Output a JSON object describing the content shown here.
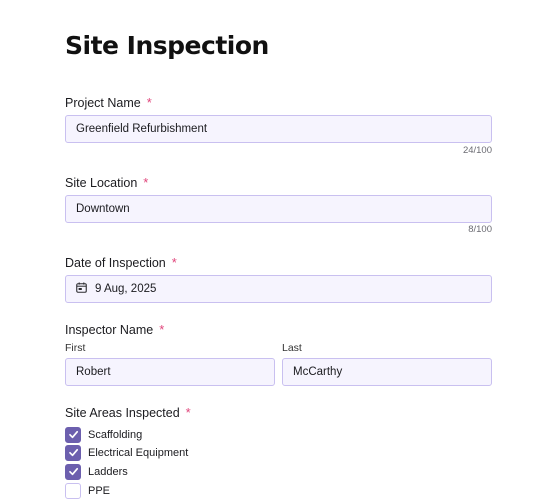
{
  "page": {
    "title": "Site Inspection"
  },
  "project_name": {
    "label": "Project Name",
    "required": "*",
    "value": "Greenfield Refurbishment",
    "counter": "24/100"
  },
  "site_location": {
    "label": "Site Location",
    "required": "*",
    "value": "Downtown",
    "counter": "8/100"
  },
  "date_of_inspection": {
    "label": "Date of Inspection",
    "required": "*",
    "value": "9 Aug, 2025",
    "icon": "calendar-icon"
  },
  "inspector_name": {
    "label": "Inspector Name",
    "required": "*",
    "first_label": "First",
    "first_value": "Robert",
    "last_label": "Last",
    "last_value": "McCarthy"
  },
  "site_areas": {
    "label": "Site Areas Inspected",
    "required": "*",
    "options": [
      {
        "label": "Scaffolding",
        "checked": true
      },
      {
        "label": "Electrical Equipment",
        "checked": true
      },
      {
        "label": "Ladders",
        "checked": true
      },
      {
        "label": "PPE",
        "checked": false
      }
    ]
  },
  "colors": {
    "accent": "#6c5fae",
    "required": "#e0457b",
    "field_bg": "#f6f4fe",
    "field_border": "#c9c0f0"
  }
}
